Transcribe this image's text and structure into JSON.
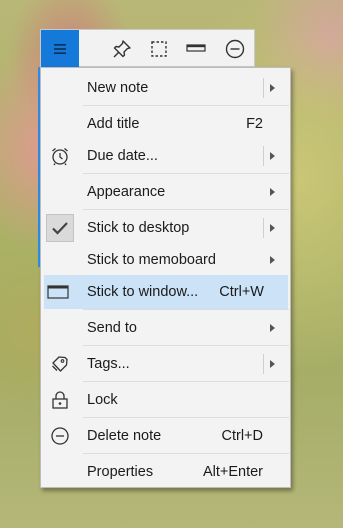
{
  "toolbar": {
    "buttons": [
      {
        "name": "menu",
        "icon": "hamburger-icon",
        "active": true
      },
      {
        "name": "pin",
        "icon": "pin-icon"
      },
      {
        "name": "select",
        "icon": "dashed-rectangle-icon"
      },
      {
        "name": "title",
        "icon": "title-bar-icon"
      },
      {
        "name": "minimize",
        "icon": "minus-circle-icon"
      }
    ],
    "accent_color": "#1479d8"
  },
  "menu": {
    "highlight_color": "#cce2f6",
    "items": [
      {
        "label": "New note",
        "shortcut": "",
        "submenu": true,
        "split": true,
        "icon": ""
      },
      {
        "label": "Add title",
        "shortcut": "F2",
        "submenu": false,
        "icon": ""
      },
      {
        "label": "Due date...",
        "shortcut": "",
        "submenu": true,
        "split": true,
        "icon": "alarm-clock-icon"
      },
      {
        "label": "Appearance",
        "shortcut": "",
        "submenu": true,
        "icon": ""
      },
      {
        "label": "Stick to desktop",
        "shortcut": "",
        "submenu": true,
        "split": true,
        "icon": "checkmark-icon",
        "checked": true
      },
      {
        "label": "Stick to memoboard",
        "shortcut": "",
        "submenu": true,
        "icon": ""
      },
      {
        "label": "Stick to window...",
        "shortcut": "Ctrl+W",
        "submenu": false,
        "icon": "window-icon",
        "highlighted": true
      },
      {
        "label": "Send to",
        "shortcut": "",
        "submenu": true,
        "icon": ""
      },
      {
        "label": "Tags...",
        "shortcut": "",
        "submenu": true,
        "split": true,
        "icon": "tag-icon"
      },
      {
        "label": "Lock",
        "shortcut": "",
        "submenu": false,
        "icon": "padlock-icon"
      },
      {
        "label": "Delete note",
        "shortcut": "Ctrl+D",
        "submenu": false,
        "icon": "minus-circle-icon"
      },
      {
        "label": "Properties",
        "shortcut": "Alt+Enter",
        "submenu": false,
        "icon": ""
      }
    ]
  }
}
